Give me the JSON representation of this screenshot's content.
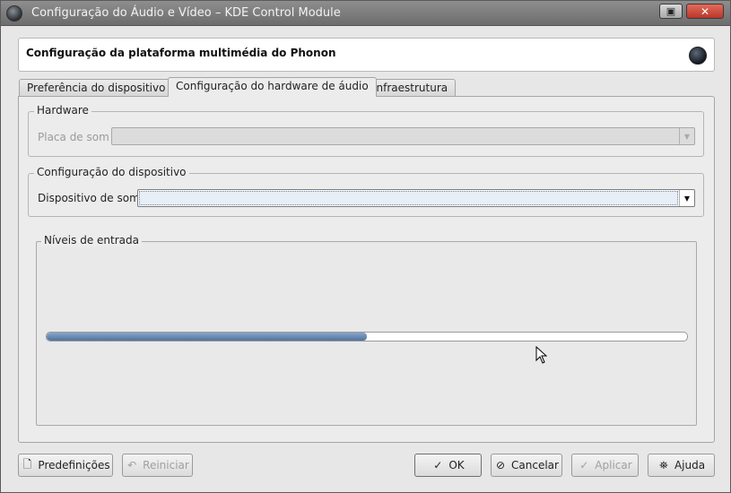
{
  "window": {
    "title": "Configuração do Áudio e Vídeo – KDE Control Module",
    "maximize_glyph": "▣",
    "close_glyph": "✕"
  },
  "header": {
    "title": "Configuração da plataforma multimédia do Phonon"
  },
  "tabs": [
    {
      "label": "Preferência do dispositivo",
      "active": false
    },
    {
      "label": "Configuração do hardware de áudio",
      "active": true
    },
    {
      "label": "Infraestrutura",
      "active": false
    }
  ],
  "hardware_group": {
    "title": "Hardware",
    "sound_card_label": "Placa de som",
    "sound_card_value": ""
  },
  "device_group": {
    "title": "Configuração do dispositivo",
    "sound_device_label": "Dispositivo de som",
    "sound_device_value": ""
  },
  "input_levels": {
    "title": "Níveis de entrada",
    "level_fraction": 0.5
  },
  "buttons": {
    "defaults": {
      "label": "Predefinições",
      "icon": "defaults-icon"
    },
    "reset": {
      "label": "Reiniciar",
      "icon": "undo-icon"
    },
    "ok": {
      "label": "OK",
      "icon": "check-icon"
    },
    "cancel": {
      "label": "Cancelar",
      "icon": "cancel-icon"
    },
    "apply": {
      "label": "Aplicar",
      "icon": "check-icon"
    },
    "help": {
      "label": "Ajuda",
      "icon": "help-icon"
    }
  },
  "colors": {
    "titlebar": "#7d7d7d",
    "progress_fill": "#5f81ab",
    "close_button": "#c9473a"
  }
}
